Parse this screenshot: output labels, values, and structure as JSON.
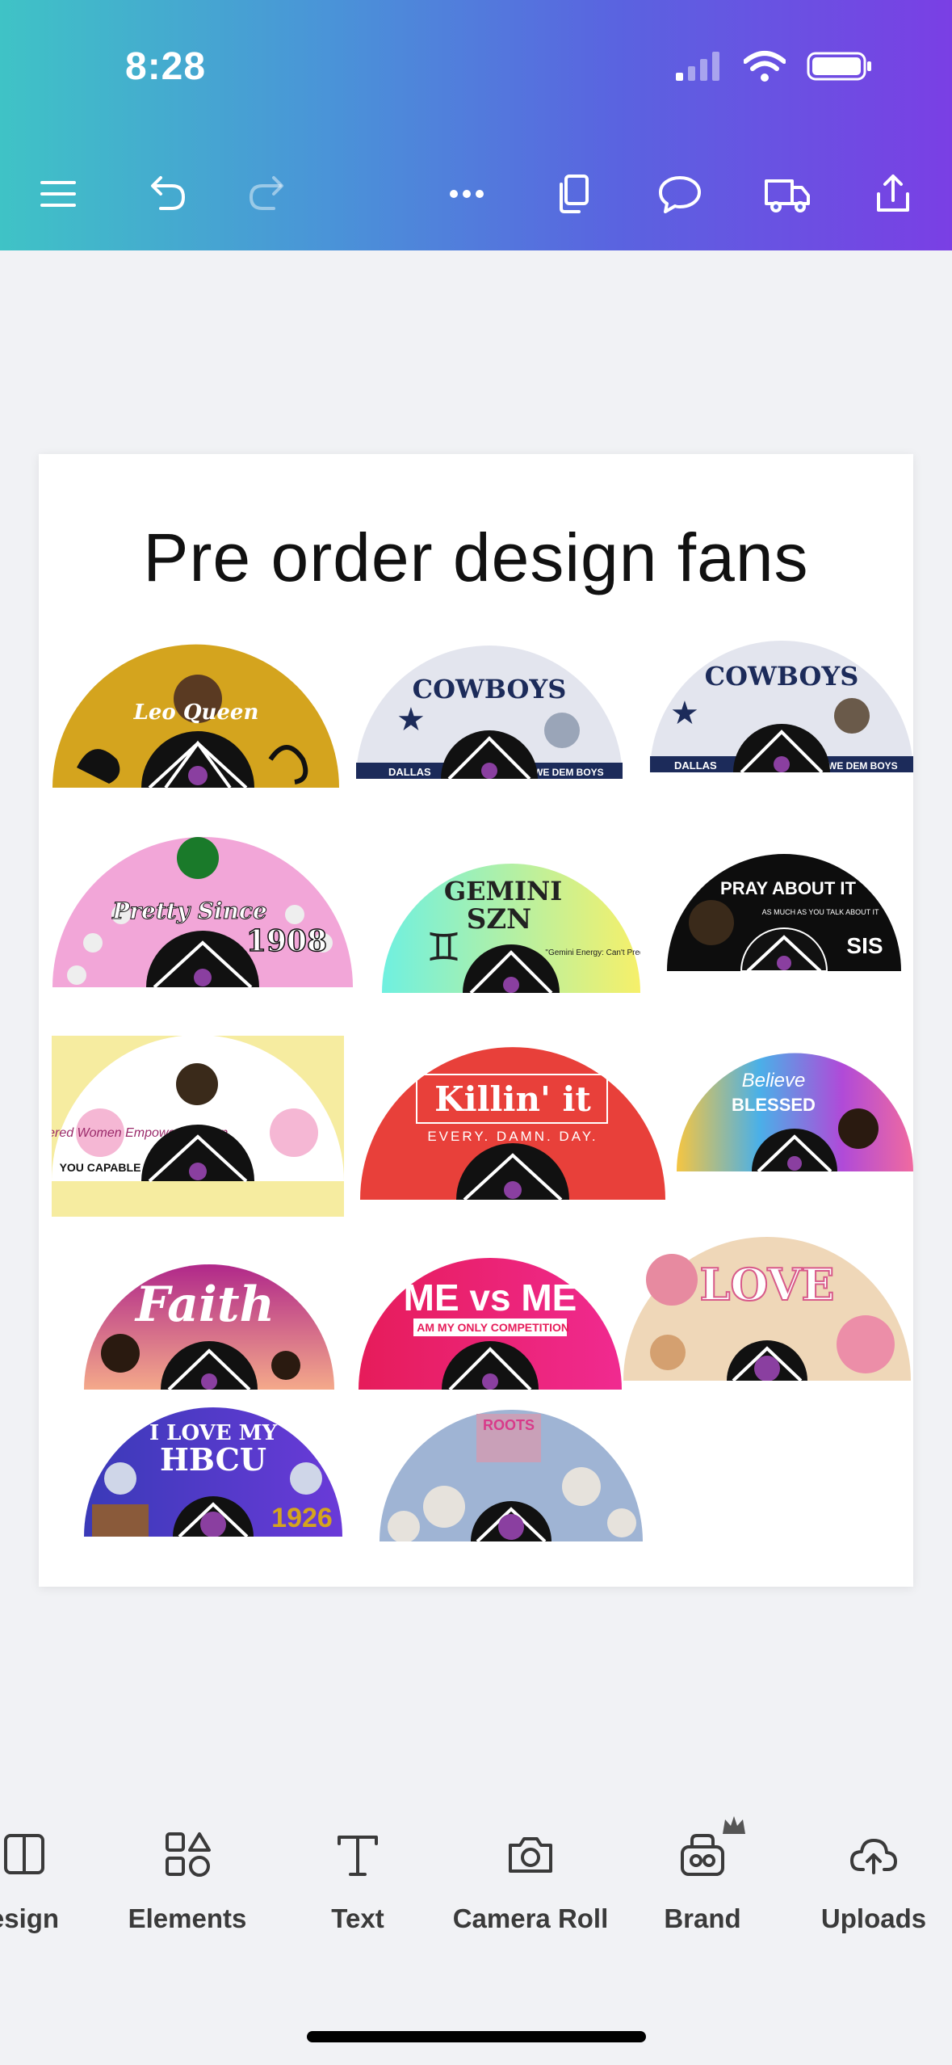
{
  "status_bar": {
    "time": "8:28"
  },
  "page": {
    "title": "Pre order design fans"
  },
  "fans": [
    {
      "main": "Leo Queen",
      "sub": ""
    },
    {
      "main": "COWBOYS",
      "sub": "DALLAS",
      "sub2": "WE DEM BOYS"
    },
    {
      "main": "COWBOYS",
      "sub": "DALLAS",
      "sub2": "WE DEM BOYS"
    },
    {
      "main": "Pretty Since",
      "sub": "1908"
    },
    {
      "main": "GEMINI",
      "sub": "SZN",
      "sub2": "\"Gemini Energy: Can't Predict Me.\""
    },
    {
      "main": "PRAY ABOUT IT",
      "sub": "AS MUCH AS YOU TALK ABOUT IT",
      "sub2": "SIS"
    },
    {
      "main": "Empowered Women Empower Women",
      "sub": "YOU CAPABLE"
    },
    {
      "main": "Killin' it",
      "sub": "EVERY. DAMN. DAY."
    },
    {
      "main": "Believe",
      "sub": "BLESSED"
    },
    {
      "main": "Faith",
      "sub": ""
    },
    {
      "main": "ME vs ME",
      "sub": "I AM MY ONLY COMPETITION"
    },
    {
      "main": "LOVE",
      "sub": ""
    },
    {
      "main": "I LOVE MY",
      "sub": "HBCU",
      "sub2": "1926"
    },
    {
      "main": "ROOTS",
      "sub": ""
    }
  ],
  "bottom_nav": {
    "items": [
      {
        "label": "esign"
      },
      {
        "label": "Elements"
      },
      {
        "label": "Text"
      },
      {
        "label": "Camera Roll"
      },
      {
        "label": "Brand"
      },
      {
        "label": "Uploads"
      }
    ]
  },
  "colors": {
    "accent_start": "#3fc3c6",
    "accent_end": "#7a3fe4",
    "canvas_bg": "#f1f2f5"
  }
}
